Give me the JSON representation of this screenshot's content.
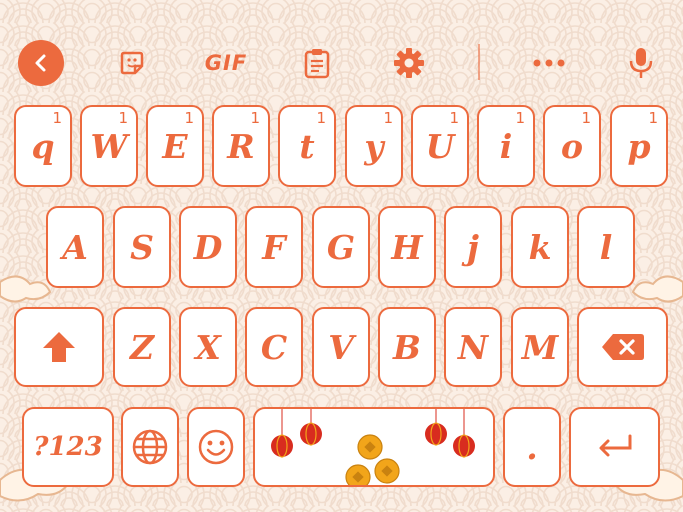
{
  "toolbar": {
    "back_icon": "chevron-left-icon",
    "sticker_icon": "sticker-icon",
    "gif_label": "GIF",
    "clipboard_icon": "clipboard-icon",
    "settings_icon": "gear-icon",
    "more_icon": "more-dots-icon",
    "mic_icon": "microphone-icon"
  },
  "rows": {
    "row1": [
      {
        "label": "q",
        "hint": "1"
      },
      {
        "label": "W",
        "hint": "1"
      },
      {
        "label": "E",
        "hint": "1"
      },
      {
        "label": "R",
        "hint": "1"
      },
      {
        "label": "t",
        "hint": "1"
      },
      {
        "label": "y",
        "hint": "1"
      },
      {
        "label": "U",
        "hint": "1"
      },
      {
        "label": "i",
        "hint": "1"
      },
      {
        "label": "o",
        "hint": "1"
      },
      {
        "label": "p",
        "hint": "1"
      }
    ],
    "row2": [
      {
        "label": "A"
      },
      {
        "label": "S"
      },
      {
        "label": "D"
      },
      {
        "label": "F"
      },
      {
        "label": "G"
      },
      {
        "label": "H"
      },
      {
        "label": "j"
      },
      {
        "label": "k"
      },
      {
        "label": "l"
      }
    ],
    "row3": [
      {
        "label": "Z"
      },
      {
        "label": "X"
      },
      {
        "label": "C"
      },
      {
        "label": "V"
      },
      {
        "label": "B"
      },
      {
        "label": "N"
      },
      {
        "label": "M"
      }
    ],
    "row4": {
      "symbols_label": "?123",
      "period_label": "."
    }
  },
  "colors": {
    "accent": "#ec6a3e",
    "background": "#fbefe5",
    "pattern": "#f0dccd",
    "key_fill": "#ffffff",
    "coin": "#f2a51a",
    "lantern": "#d82c1f"
  }
}
